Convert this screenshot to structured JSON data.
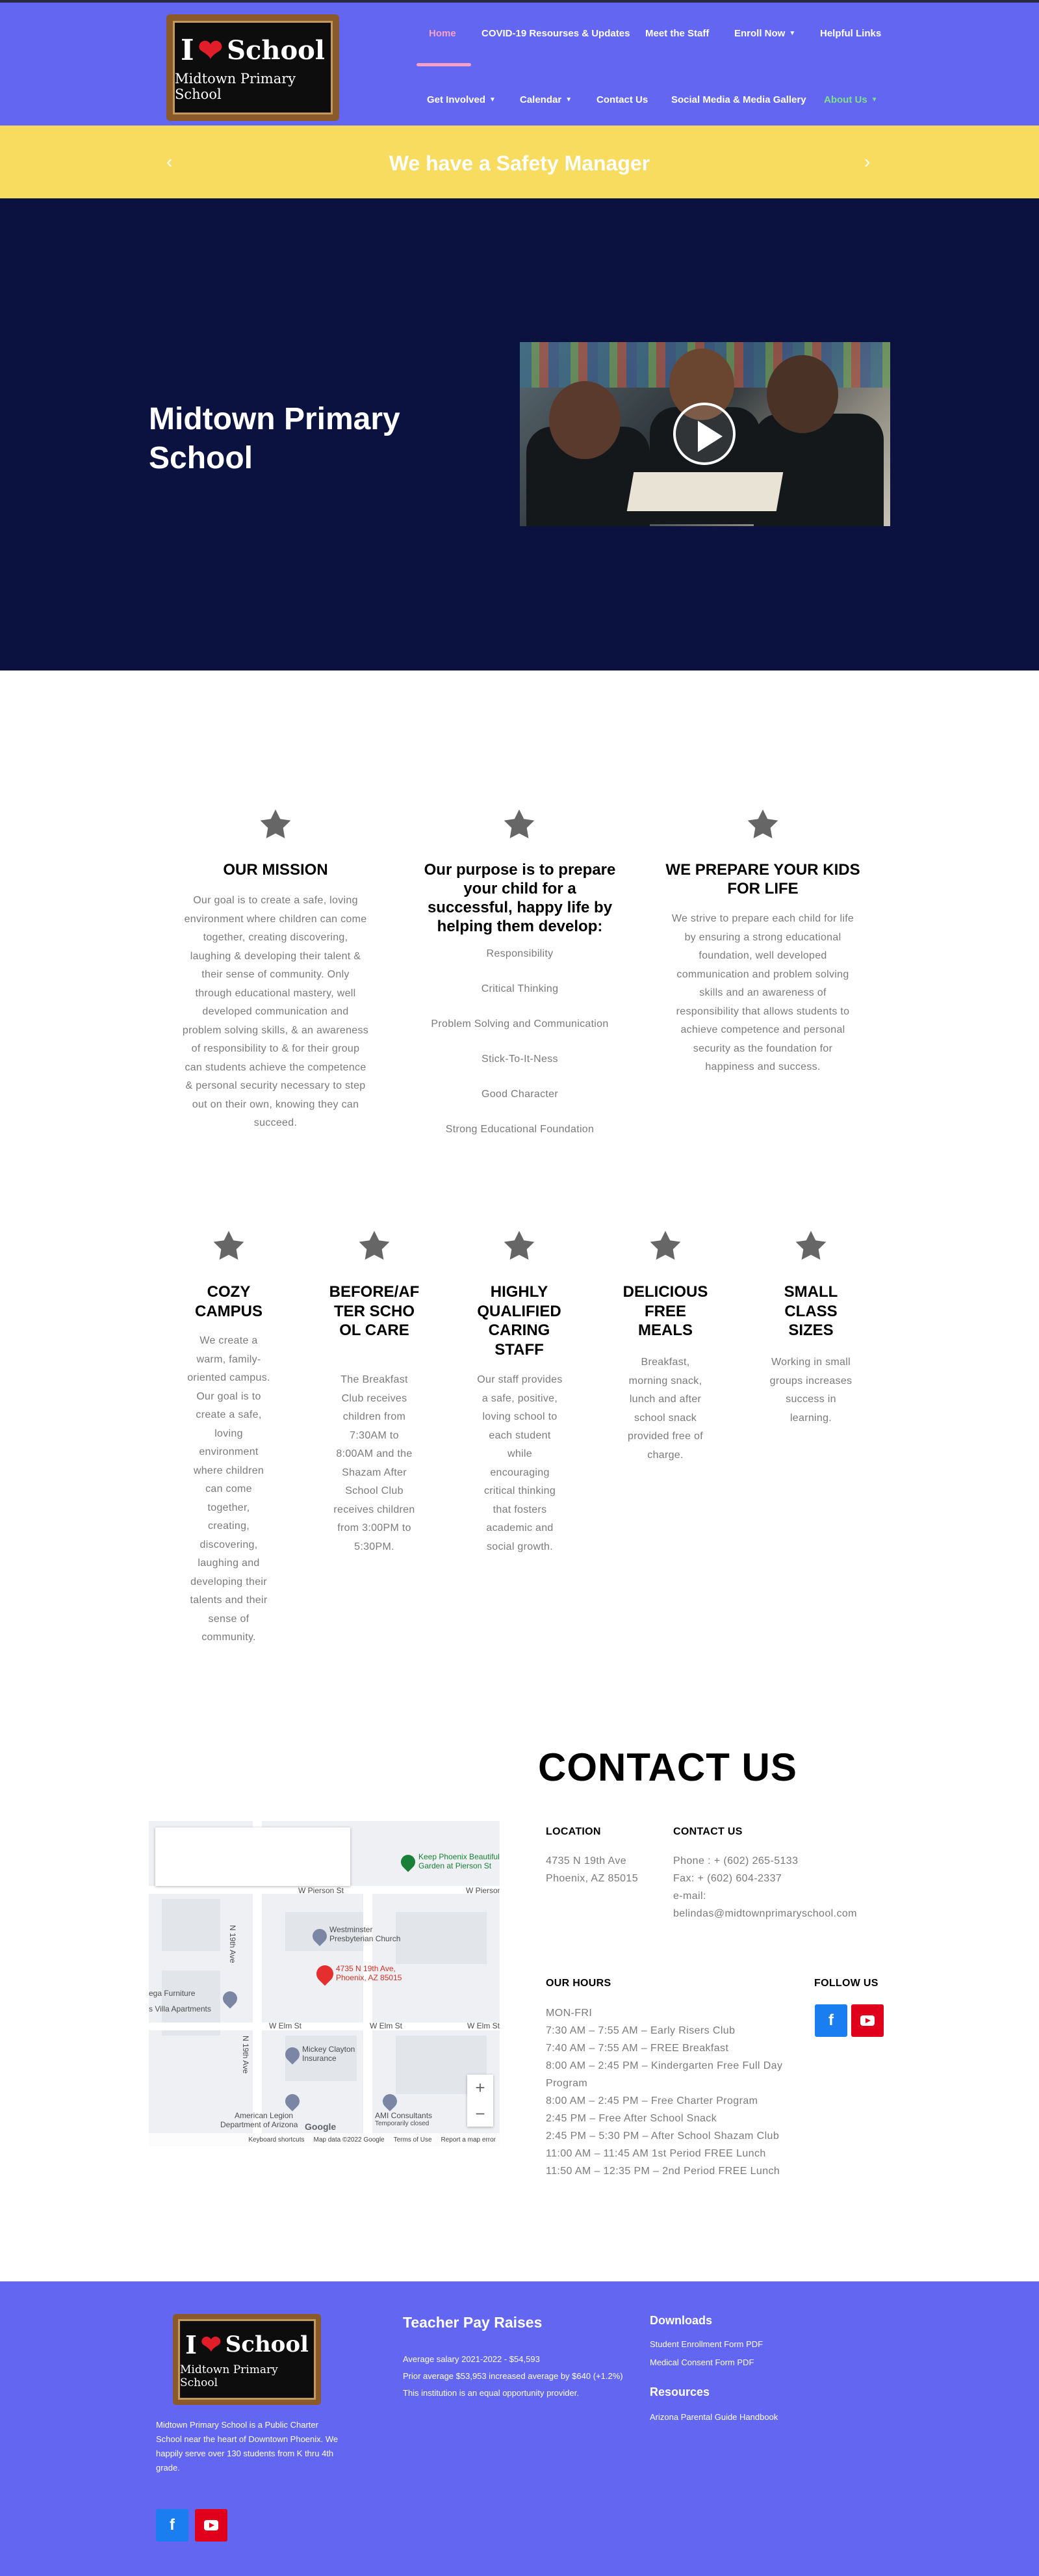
{
  "logo": {
    "line1_i": "I",
    "line1_school": "School",
    "line2": "Midtown Primary School"
  },
  "nav": {
    "home": "Home",
    "covid": "COVID-19 Resourses & Updates",
    "staff": "Meet the Staff",
    "enroll": "Enroll Now",
    "helpful": "Helpful Links",
    "involved": "Get Involved",
    "calendar": "Calendar",
    "contact": "Contact Us",
    "social": "Social Media & Media Gallery",
    "about": "About Us",
    "colors": {
      "active": "#f7a1c4",
      "current": "#7ee08a"
    }
  },
  "banner": {
    "text": "We have a Safety Manager",
    "prev": "‹",
    "next": "›",
    "color": "#f7dc5f"
  },
  "hero": {
    "title": "Midtown Primary School",
    "video_icon": "play-icon",
    "bg": "#0b1240"
  },
  "mission": {
    "title": "OUR MISSION",
    "text": "Our goal is to create a safe, loving environment where children can come together, creating discovering, laughing & developing their talent & their sense of community. Only through educational mastery, well developed communication and problem solving skills, & an awareness of responsibility to & for their group can students achieve the competence & personal security necessary to step out on their own, knowing they can succeed."
  },
  "purpose": {
    "title": "Our purpose is to prepare your child for a successful, happy life by helping them develop:",
    "items": [
      "Responsibility",
      "Critical Thinking",
      "Problem Solving and Communication",
      "Stick-To-It-Ness",
      "Good Character",
      "Strong Educational Foundation"
    ]
  },
  "prepare": {
    "title": "WE PREPARE YOUR KIDS FOR LIFE",
    "text": "We strive to prepare each child for life by ensuring a strong educational foundation, well developed communication and problem solving skills and an awareness of responsibility that allows students to achieve competence and personal security as the foundation for happiness and success."
  },
  "features": [
    {
      "title": "COZY CAMPUS",
      "text": "We create a warm, family-oriented campus. Our goal is to create a safe, loving environment where children can come together, creating, discovering, laughing and developing their talents and their sense of community."
    },
    {
      "title": "BEFORE/AFTER SCHOOL CARE",
      "text": "The Breakfast Club receives children from 7:30AM to 8:00AM and the Shazam After School Club receives children from 3:00PM to 5:30PM."
    },
    {
      "title": "HIGHLY QUALIFIED CARING STAFF",
      "text": "Our staff provides a safe, positive, loving school to each student while encouraging critical thinking that fosters academic and social growth."
    },
    {
      "title": "DELICIOUS FREE MEALS",
      "text": "Breakfast, morning snack, lunch and after school snack provided free of charge."
    },
    {
      "title": "SMALL CLASS SIZES",
      "text": "Working in small groups increases success in learning."
    }
  ],
  "contact": {
    "heading": "CONTACT US",
    "location_label": "LOCATION",
    "location_line1": "4735 N 19th Ave",
    "location_line2": "Phoenix, AZ 85015",
    "contact_label": "CONTACT US",
    "phone": "Phone : + (602) 265-5133",
    "fax": "Fax: + (602) 604-2337",
    "email_label": "e-mail:",
    "email": "belindas@midtownprimaryschool.com",
    "hours_label": "OUR HOURS",
    "hours_days": "MON-FRI",
    "hours": [
      "7:30 AM – 7:55 AM – Early Risers Club",
      "7:40 AM – 7:55 AM – FREE Breakfast",
      "8:00 AM – 2:45 PM – Kindergarten Free Full Day Program",
      "8:00 AM – 2:45 PM – Free Charter Program",
      "2:45 PM – Free After School Snack",
      "2:45 PM – 5:30 PM – After School Shazam Club",
      "11:00 AM – 11:45 AM 1st Period FREE Lunch",
      "11:50 AM – 12:35 PM – 2nd Period FREE Lunch"
    ],
    "follow_label": "FOLLOW US",
    "facebook_icon": "facebook-icon",
    "youtube_icon": "youtube-icon"
  },
  "map": {
    "w_pierson": "W Pierson St",
    "w_pierson2": "W Pierson St",
    "w_elm": "W Elm St",
    "w_elm2": "W Elm St",
    "w_elm3": "W Elm St",
    "n19": "N 19th Ave",
    "n19b": "N 19th Ave",
    "keep": "Keep Phoenix Beautiful",
    "keep2": "Garden at Pierson St",
    "westminster": "Westminster",
    "westminster2": "Presbyterian Church",
    "pin1": "4735 N 19th Ave,",
    "pin2": "Phoenix, AZ 85015",
    "furniture": "ega Furniture",
    "villa": "s Villa Apartments",
    "mickey1": "Mickey Clayton",
    "mickey2": "Insurance",
    "legion1": "American Legion",
    "legion2": "Department of Arizona",
    "amt1": "AMI Consultants",
    "amt2": "Temporarily closed",
    "google": "Google",
    "keyboard": "Keyboard shortcuts",
    "mapdata": "Map data ©2022 Google",
    "terms": "Terms of Use",
    "report": "Report a map error",
    "zoom_in": "+",
    "zoom_out": "−"
  },
  "footer": {
    "about": "Midtown Primary School is a Public Charter School near the heart of Downtown Phoenix. We happily serve over 130 students from K thru 4th grade.",
    "pay_title": "Teacher Pay Raises",
    "pay1": "Average salary 2021-2022 - $54,593",
    "pay2": "Prior average $53,953 increased average by $640 (+1.2%)",
    "pay3": "This institution is an equal opportunity provider.",
    "downloads_title": "Downloads",
    "dl1": "Student Enrollment Form PDF",
    "dl2": "Medical Consent Form PDF",
    "resources_title": "Resources",
    "res1": "Arizona Parental Guide Handbook",
    "bg": "#6366f1"
  }
}
